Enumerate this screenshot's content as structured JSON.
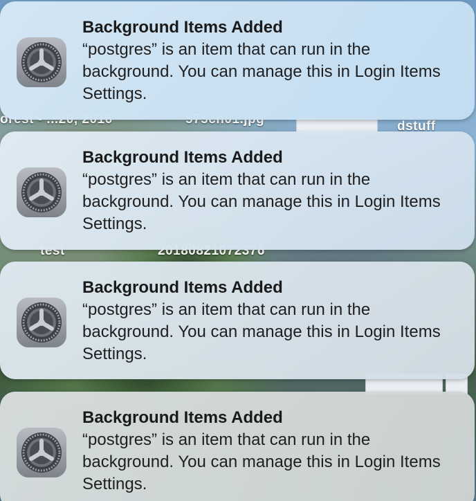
{
  "desktop": {
    "labels": [
      "orest - ...20, 2016",
      "575ch01.jpg",
      "dstuff",
      "test",
      "20180821072376"
    ]
  },
  "notifications": [
    {
      "app_icon": "gear-icon",
      "title": "Background Items Added",
      "body": "“postgres” is an item that can run in the background. You can manage this in Login Items Settings."
    },
    {
      "app_icon": "gear-icon",
      "title": "Background Items Added",
      "body": "“postgres” is an item that can run in the background. You can manage this in Login Items Settings."
    },
    {
      "app_icon": "gear-icon",
      "title": "Background Items Added",
      "body": "“postgres” is an item that can run in the background. You can manage this in Login Items Settings."
    },
    {
      "app_icon": "gear-icon",
      "title": "Background Items Added",
      "body": "“postgres” is an item that can run in the background. You can manage this in Login Items Settings."
    }
  ]
}
